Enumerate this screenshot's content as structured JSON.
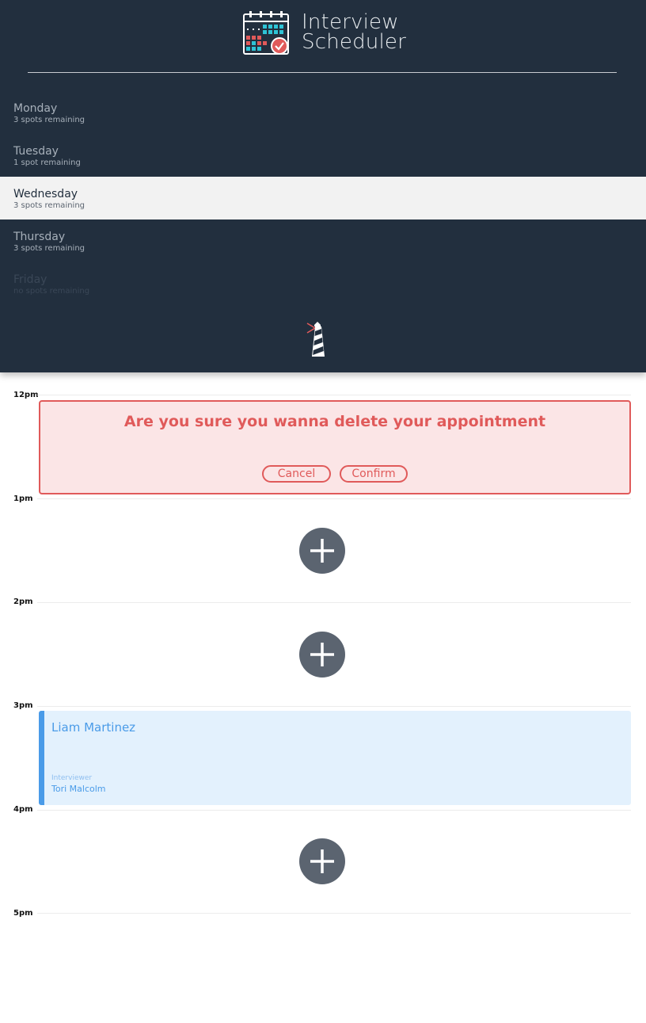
{
  "app": {
    "title_line1": "Interview",
    "title_line2": "Scheduler"
  },
  "days": [
    {
      "name": "Monday",
      "spots": "3 spots remaining"
    },
    {
      "name": "Tuesday",
      "spots": "1 spot remaining"
    },
    {
      "name": "Wednesday",
      "spots": "3 spots remaining"
    },
    {
      "name": "Thursday",
      "spots": "3 spots remaining"
    },
    {
      "name": "Friday",
      "spots": "no spots remaining"
    }
  ],
  "selected_day": "Wednesday",
  "hours": [
    "12pm",
    "1pm",
    "2pm",
    "3pm",
    "4pm",
    "5pm"
  ],
  "confirm": {
    "message": "Are you sure you wanna delete your appointment",
    "cancel_label": "Cancel",
    "confirm_label": "Confirm"
  },
  "appointment": {
    "student": "Liam Martinez",
    "interviewer_label": "Interviewer",
    "interviewer_name": "Tori Malcolm"
  },
  "colors": {
    "sidebar": "#222f3e",
    "danger": "#e05a5a",
    "accent": "#4a9be8",
    "add_button": "#5b6470"
  },
  "icons": {
    "logo": "calendar-check-icon",
    "footer": "lighthouse-icon",
    "add": "plus-icon"
  }
}
